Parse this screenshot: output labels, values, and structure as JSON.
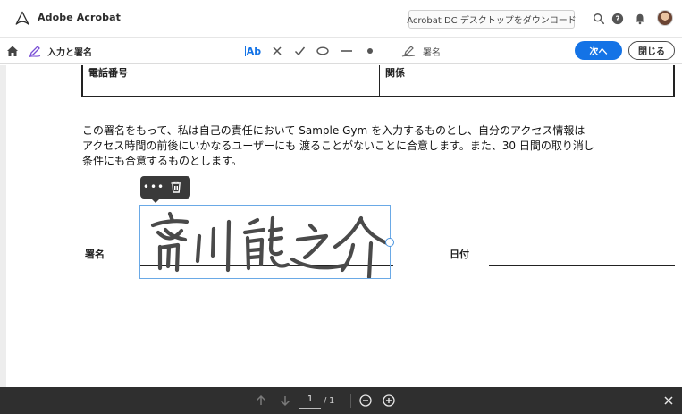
{
  "app": {
    "title": "Adobe Acrobat",
    "download_label": "Acrobat DC デスクトップをダウンロード"
  },
  "toolbar": {
    "mode_label": "入力と署名",
    "text_tool_label": "Ab",
    "sign_label": "署名",
    "next_label": "次へ",
    "close_label": "閉じる"
  },
  "document": {
    "table": {
      "phone_label": "電話番号",
      "relation_label": "関係"
    },
    "consent_lines": [
      "この署名をもって、私は自己の責任において Sample Gym を入力するものとし、自分のアクセス情報は",
      "アクセス時間の前後にいかなるユーザーにも 渡ることがないことに合意します。また、30 日間の取り消し",
      "条件にも合意するものとします。"
    ],
    "signature_label": "署名",
    "signature_text": "斉川 龍之介",
    "date_label": "日付",
    "popover_more": "•••"
  },
  "pager": {
    "current_page": "1",
    "separator": "/",
    "total_pages": "1"
  },
  "colors": {
    "accent": "#1473e6",
    "bottom_bar": "#2f2f2f",
    "selection": "#6aa9e6"
  }
}
